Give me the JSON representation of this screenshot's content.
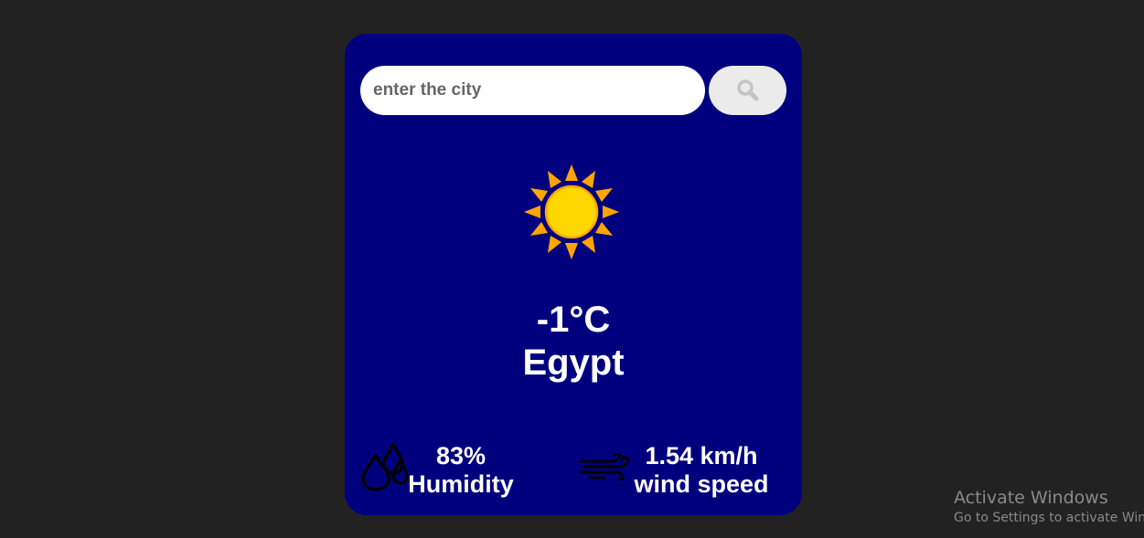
{
  "search": {
    "placeholder": "enter the city",
    "value": "",
    "button_icon": "search-icon"
  },
  "weather": {
    "icon": "sun-icon",
    "temperature": "-1°C",
    "city": "Egypt"
  },
  "details": {
    "humidity": {
      "icon": "humidity-drops-icon",
      "value": "83%",
      "label": "Humidity"
    },
    "wind": {
      "icon": "wind-icon",
      "value": "1.54 km/h",
      "label": "wind speed"
    }
  },
  "os_watermark": {
    "title": "Activate Windows",
    "subtitle": "Go to Settings to activate Windows."
  },
  "colors": {
    "page_background": "#222222",
    "card_background": "#00007f",
    "sun_core": "#ffd700",
    "sun_rays": "#ffa500"
  }
}
